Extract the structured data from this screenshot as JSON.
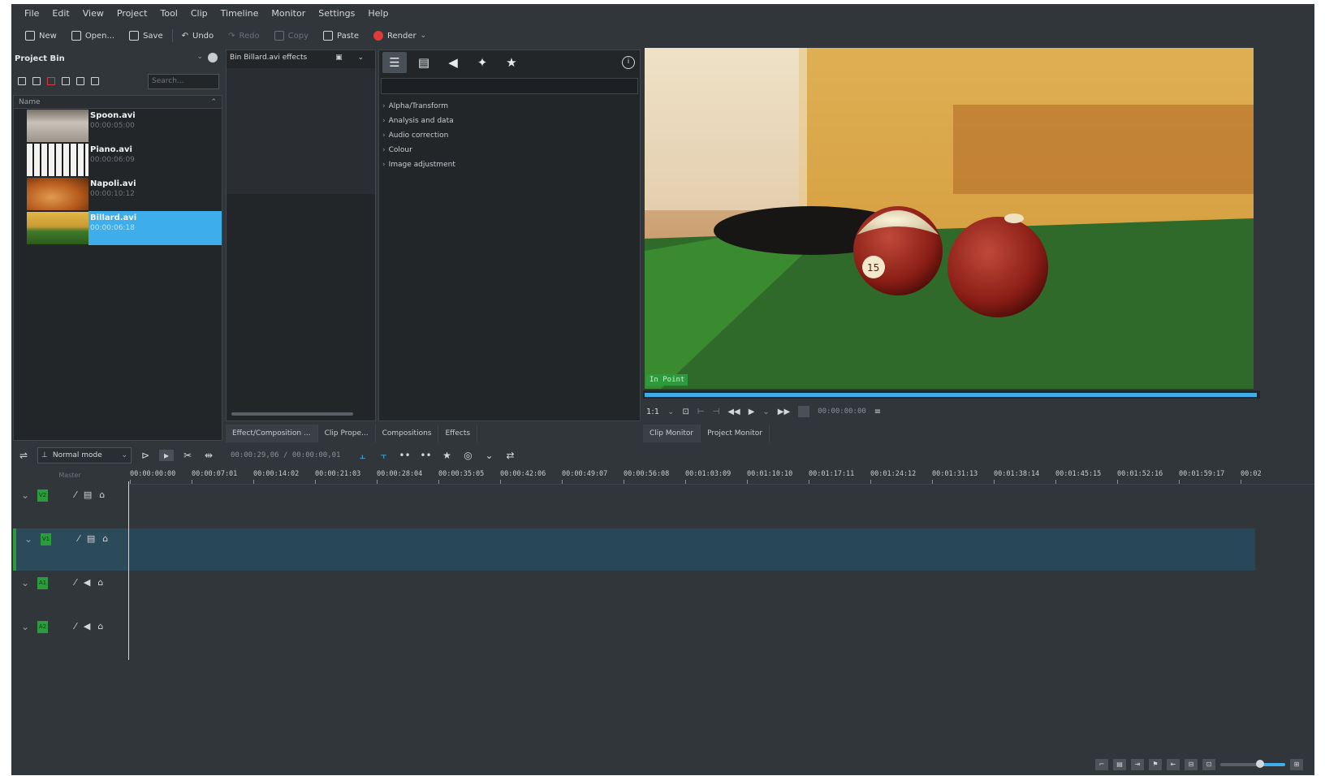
{
  "menu": [
    "File",
    "Edit",
    "View",
    "Project",
    "Tool",
    "Clip",
    "Timeline",
    "Monitor",
    "Settings",
    "Help"
  ],
  "toolbar": {
    "new": "New",
    "open": "Open...",
    "save": "Save",
    "undo": "Undo",
    "redo": "Redo",
    "copy": "Copy",
    "paste": "Paste",
    "render": "Render"
  },
  "project_bin": {
    "title": "Project Bin",
    "search_placeholder": "Search...",
    "column_name": "Name",
    "clips": [
      {
        "name": "Spoon.avi",
        "duration": "00:00:05:00"
      },
      {
        "name": "Piano.avi",
        "duration": "00:00:06:09"
      },
      {
        "name": "Napoli.avi",
        "duration": "00:00:10:12"
      },
      {
        "name": "Billard.avi",
        "duration": "00:00:06:18",
        "selected": true
      }
    ]
  },
  "effect_stack": {
    "title": "Bin Billard.avi effects"
  },
  "effects": {
    "categories": [
      "Alpha/Transform",
      "Analysis and data",
      "Audio correction",
      "Colour",
      "Image adjustment"
    ]
  },
  "panel_tabs": [
    "Effect/Composition ...",
    "Clip Prope...",
    "Compositions",
    "Effects"
  ],
  "monitor": {
    "in_point": "In Point",
    "zoom": "1:1",
    "timecode": "00:00:00:00",
    "tabs": [
      "Clip Monitor",
      "Project Monitor"
    ],
    "progress": 1.0
  },
  "timeline_toolbar": {
    "mode": "Normal mode",
    "timecodes": "00:00:29,06 / 00:00:00,01"
  },
  "timeline": {
    "header_label": "Master",
    "ruler": [
      "00:00:00:00",
      "00:00:07:01",
      "00:00:14:02",
      "00:00:21:03",
      "00:00:28:04",
      "00:00:35:05",
      "00:00:42:06",
      "00:00:49:07",
      "00:00:56:08",
      "00:01:03:09",
      "00:01:10:10",
      "00:01:17:11",
      "00:01:24:12",
      "00:01:31:13",
      "00:01:38:14",
      "00:01:45:15",
      "00:01:52:16",
      "00:01:59:17",
      "00:02"
    ],
    "tracks": [
      {
        "name": "V2",
        "kind": "video"
      },
      {
        "name": "V1",
        "kind": "video",
        "selected": true
      },
      {
        "name": "A1",
        "kind": "audio"
      },
      {
        "name": "A2",
        "kind": "audio"
      }
    ]
  },
  "colors": {
    "accent": "#3daee9",
    "window_bg": "#31363b",
    "panel_bg": "#232629",
    "track_badge": "#2e9a3e",
    "record": "#e03b3b"
  }
}
